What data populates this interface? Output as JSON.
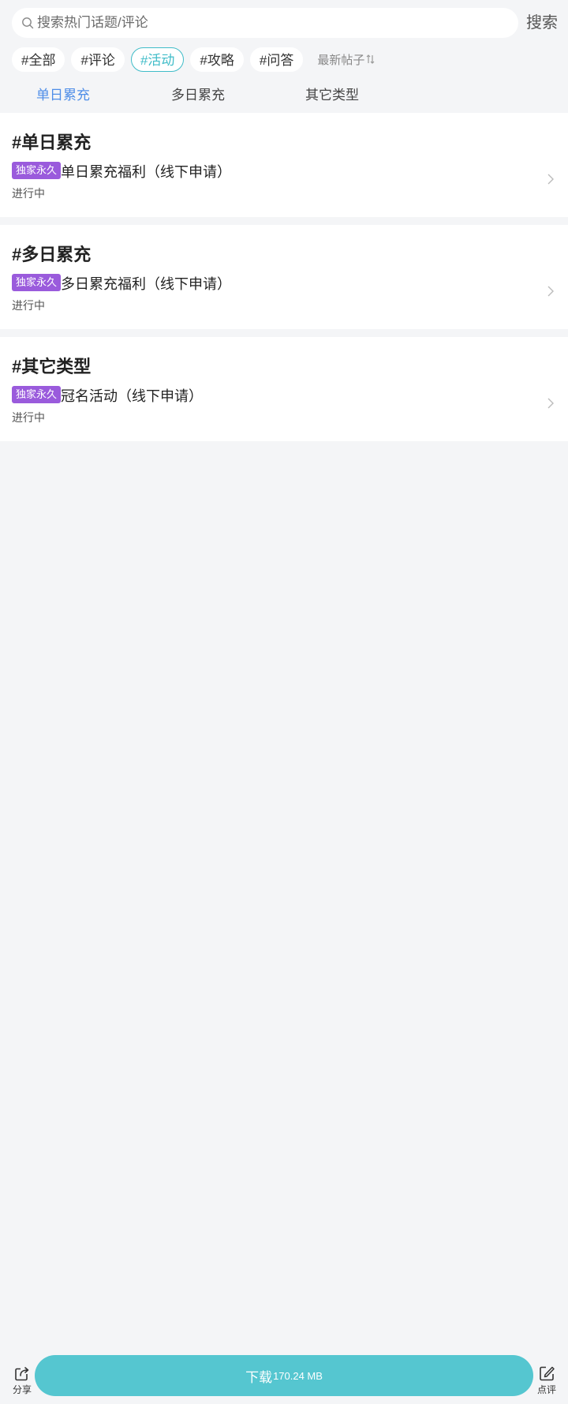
{
  "search": {
    "placeholder": "搜索热门话题/评论",
    "button_label": "搜索"
  },
  "filters": {
    "chips": [
      "#全部",
      "#评论",
      "#活动",
      "#攻略",
      "#问答"
    ],
    "active": "#活动",
    "sort_label": "最新帖子"
  },
  "tabs": {
    "items": [
      "单日累充",
      "多日累充",
      "其它类型"
    ],
    "active": "单日累充",
    "active_color": "#4f8ee8"
  },
  "sections": [
    {
      "title": "#单日累充",
      "badge": "独家永久",
      "item_title": "单日累充福利（线下申请）",
      "status": "进行中"
    },
    {
      "title": "#多日累充",
      "badge": "独家永久",
      "item_title": "多日累充福利（线下申请）",
      "status": "进行中"
    },
    {
      "title": "#其它类型",
      "badge": "独家永久",
      "item_title": "冠名活动（线下申请）",
      "status": "进行中"
    }
  ],
  "bottom_bar": {
    "share_label": "分享",
    "download_label": "下载",
    "download_size": "170.24 MB",
    "review_label": "点评"
  },
  "colors": {
    "accent": "#3fbcc8",
    "download_bg": "#55c6d0",
    "badge_bg": "#9a5bdc",
    "page_bg": "#f4f5f7"
  },
  "icons": [
    "search-icon",
    "sort-icon",
    "chevron-right-icon",
    "share-icon",
    "edit-icon"
  ]
}
